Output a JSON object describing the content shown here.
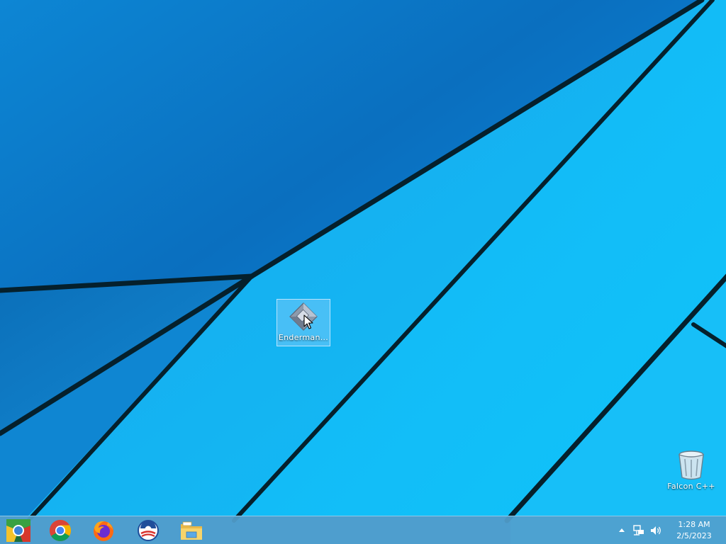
{
  "desktop": {
    "icons": [
      {
        "label": "Enderman...",
        "icon": "diamond-app-icon",
        "selected": true
      },
      {
        "label": "Falcon C++",
        "icon": "recycle-bin-icon",
        "selected": false
      }
    ]
  },
  "taskbar": {
    "start_icon": "start-orb-icon",
    "pinned": [
      {
        "name": "Google Chrome",
        "icon": "chrome-icon"
      },
      {
        "name": "Firefox",
        "icon": "firefox-icon"
      },
      {
        "name": "Obama",
        "icon": "obama-logo-icon"
      },
      {
        "name": "File Explorer",
        "icon": "file-explorer-icon"
      }
    ],
    "tray": {
      "icons": [
        "show-hidden-icons-chevron",
        "network-icon",
        "volume-icon"
      ]
    },
    "clock": {
      "time": "1:28 AM",
      "date": "2/5/2023"
    }
  },
  "colors": {
    "wallpaper_light": "#17b7f6",
    "wallpaper_dark": "#0a73c2",
    "taskbar": "#52a0cd",
    "selection": "#a9d6ff"
  }
}
